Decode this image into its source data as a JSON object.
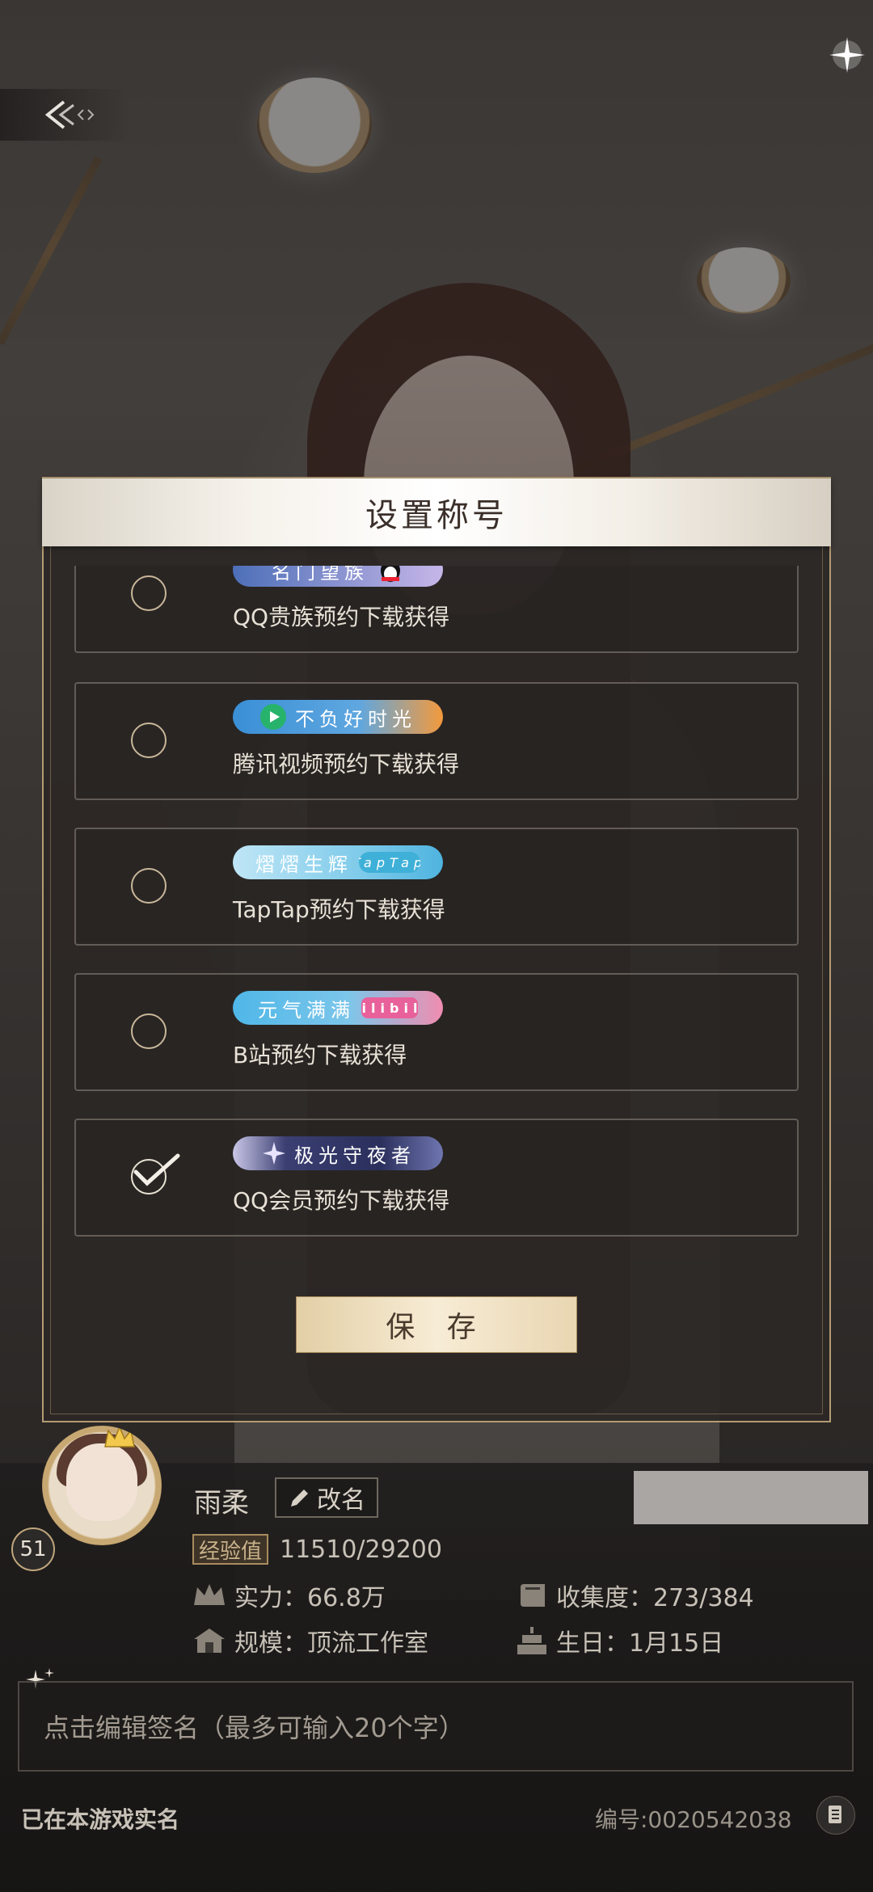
{
  "dialog": {
    "title": "设置称号",
    "save_label": "保 存",
    "titles": [
      {
        "badge_text": "名门望族",
        "source": "QQ贵族预约下载获得",
        "checked": false,
        "colors": [
          "#4d6fb8",
          "#c6b6e8"
        ],
        "partner": "QQ"
      },
      {
        "badge_text": "不负好时光",
        "source": "腾讯视频预约下载获得",
        "checked": false,
        "colors": [
          "#3a8fd6",
          "#f39a3d"
        ],
        "partner": "腾讯视频"
      },
      {
        "badge_text": "熠熠生辉",
        "source": "TapTap预约下载获得",
        "checked": false,
        "colors": [
          "#9cd6f0",
          "#4fb4df"
        ],
        "partner": "TapTap"
      },
      {
        "badge_text": "元气满满",
        "source": "B站预约下载获得",
        "checked": false,
        "colors": [
          "#4fb7e8",
          "#f08db0"
        ],
        "partner": "bilibili"
      },
      {
        "badge_text": "极光守夜者",
        "source": "QQ会员预约下载获得",
        "checked": true,
        "colors": [
          "#2a2f5c",
          "#6f76b0"
        ],
        "partner": "QQ会员"
      }
    ]
  },
  "profile": {
    "name": "雨柔",
    "rename_label": "改名",
    "level": "51",
    "exp_label": "经验值",
    "exp_value": "11510/29200",
    "power": "实力：66.8万",
    "collection": "收集度：273/384",
    "scale": "规模：顶流工作室",
    "birthday": "生日：1月15日",
    "signature_placeholder": "点击编辑签名（最多可输入20个字）",
    "realname_status": "已在本游戏实名",
    "player_id": "编号:0020542038"
  }
}
